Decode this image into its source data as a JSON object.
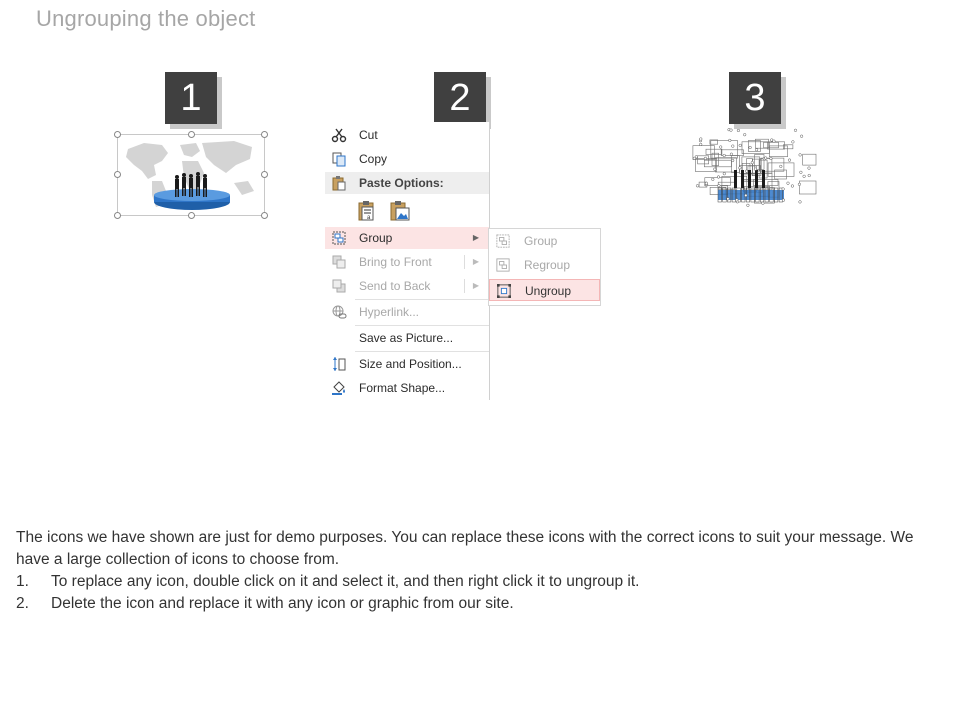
{
  "title": "Ungrouping the object",
  "steps": [
    "1",
    "2",
    "3"
  ],
  "context_menu": {
    "cut": "Cut",
    "copy": "Copy",
    "paste_options": "Paste Options:",
    "group": "Group",
    "bring_to_front": "Bring to Front",
    "send_to_back": "Send to Back",
    "hyperlink": "Hyperlink...",
    "save_as_picture": "Save as Picture...",
    "size_and_position": "Size and Position...",
    "format_shape": "Format Shape..."
  },
  "submenu": {
    "group": "Group",
    "regroup": "Regroup",
    "ungroup": "Ungroup"
  },
  "body": {
    "intro": "The icons we have shown are just for demo purposes. You can replace these icons with the correct icons to suit your message. We have a large collection of icons to choose from.",
    "items": [
      {
        "num": "1.",
        "text": "To replace any icon, double click on it and select it, and then right click it to ungroup it."
      },
      {
        "num": "2.",
        "text": "Delete the icon and replace it with any icon or graphic from our site."
      }
    ]
  },
  "colors": {
    "step_badge": "#404040",
    "highlight": "#fce4e4",
    "platform_blue": "#2e75c8"
  }
}
